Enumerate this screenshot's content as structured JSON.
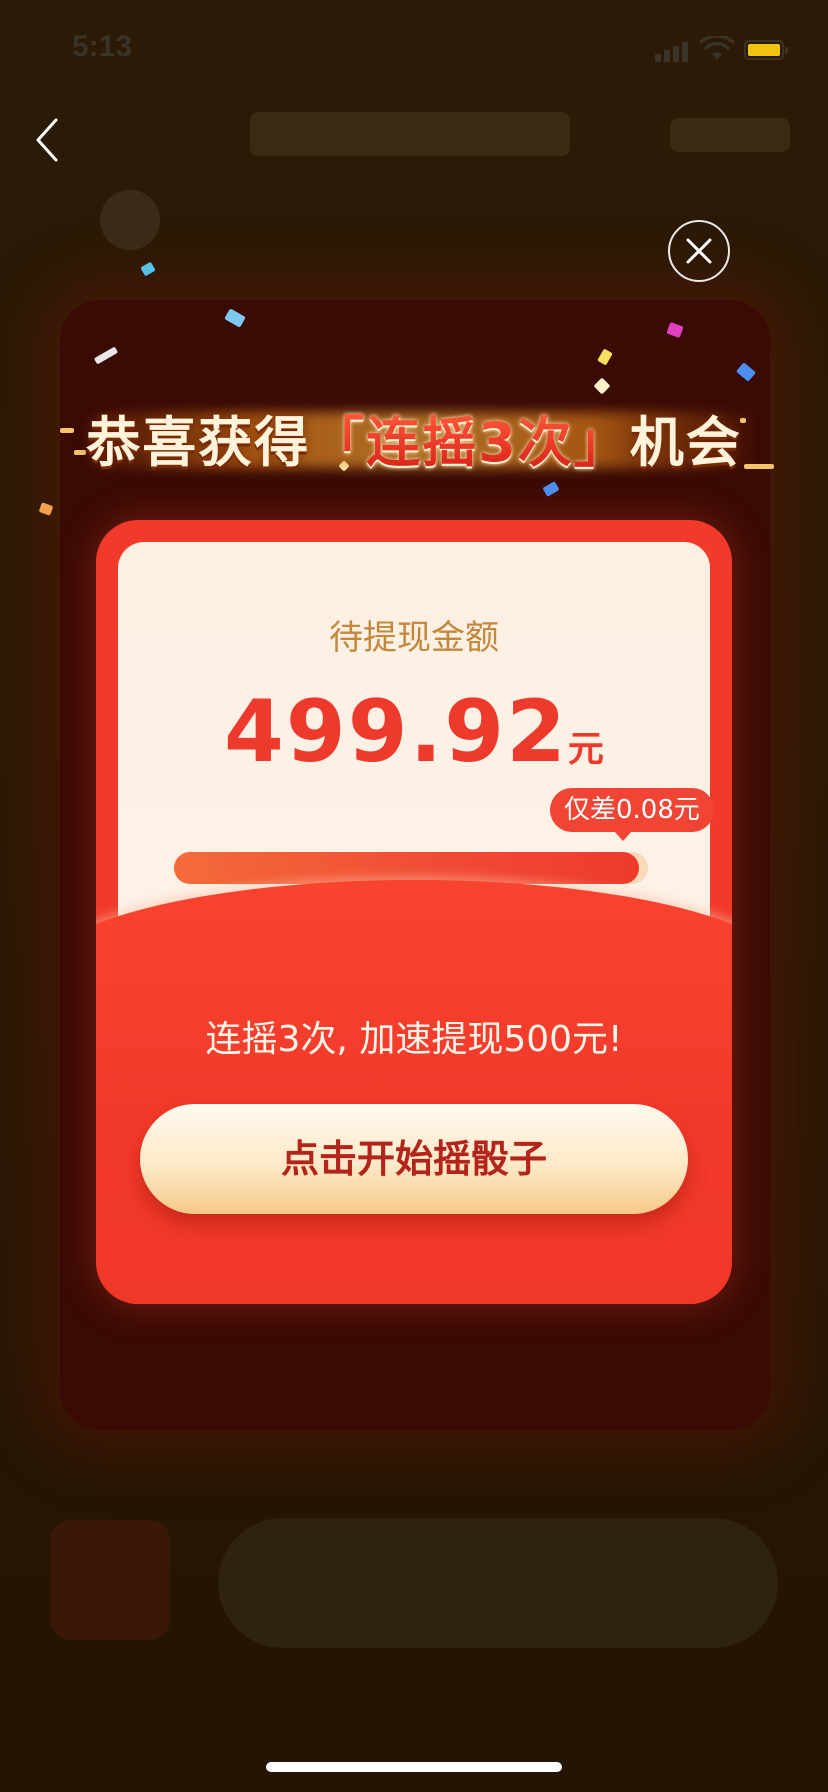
{
  "status_bar": {
    "time": "5:13",
    "battery_color": "#f1c40f"
  },
  "nav": {
    "back_icon": "chevron-left-icon"
  },
  "modal": {
    "close_icon": "close-icon",
    "headline_prefix": "恭喜获得",
    "headline_highlight": "「连摇3次」",
    "headline_suffix": "机会",
    "pending_label": "待提现金额",
    "amount": "499.92",
    "amount_unit": "元",
    "diff_badge": "仅差0.08元",
    "progress": 0.98,
    "promo_text": "连摇3次, 加速提现500元!",
    "start_button": "点击开始摇骰子"
  },
  "colors": {
    "card_red": "#f23a2a",
    "amount_red": "#ee3a2d",
    "label_gold": "#c4883c",
    "button_text": "#b3251a"
  }
}
